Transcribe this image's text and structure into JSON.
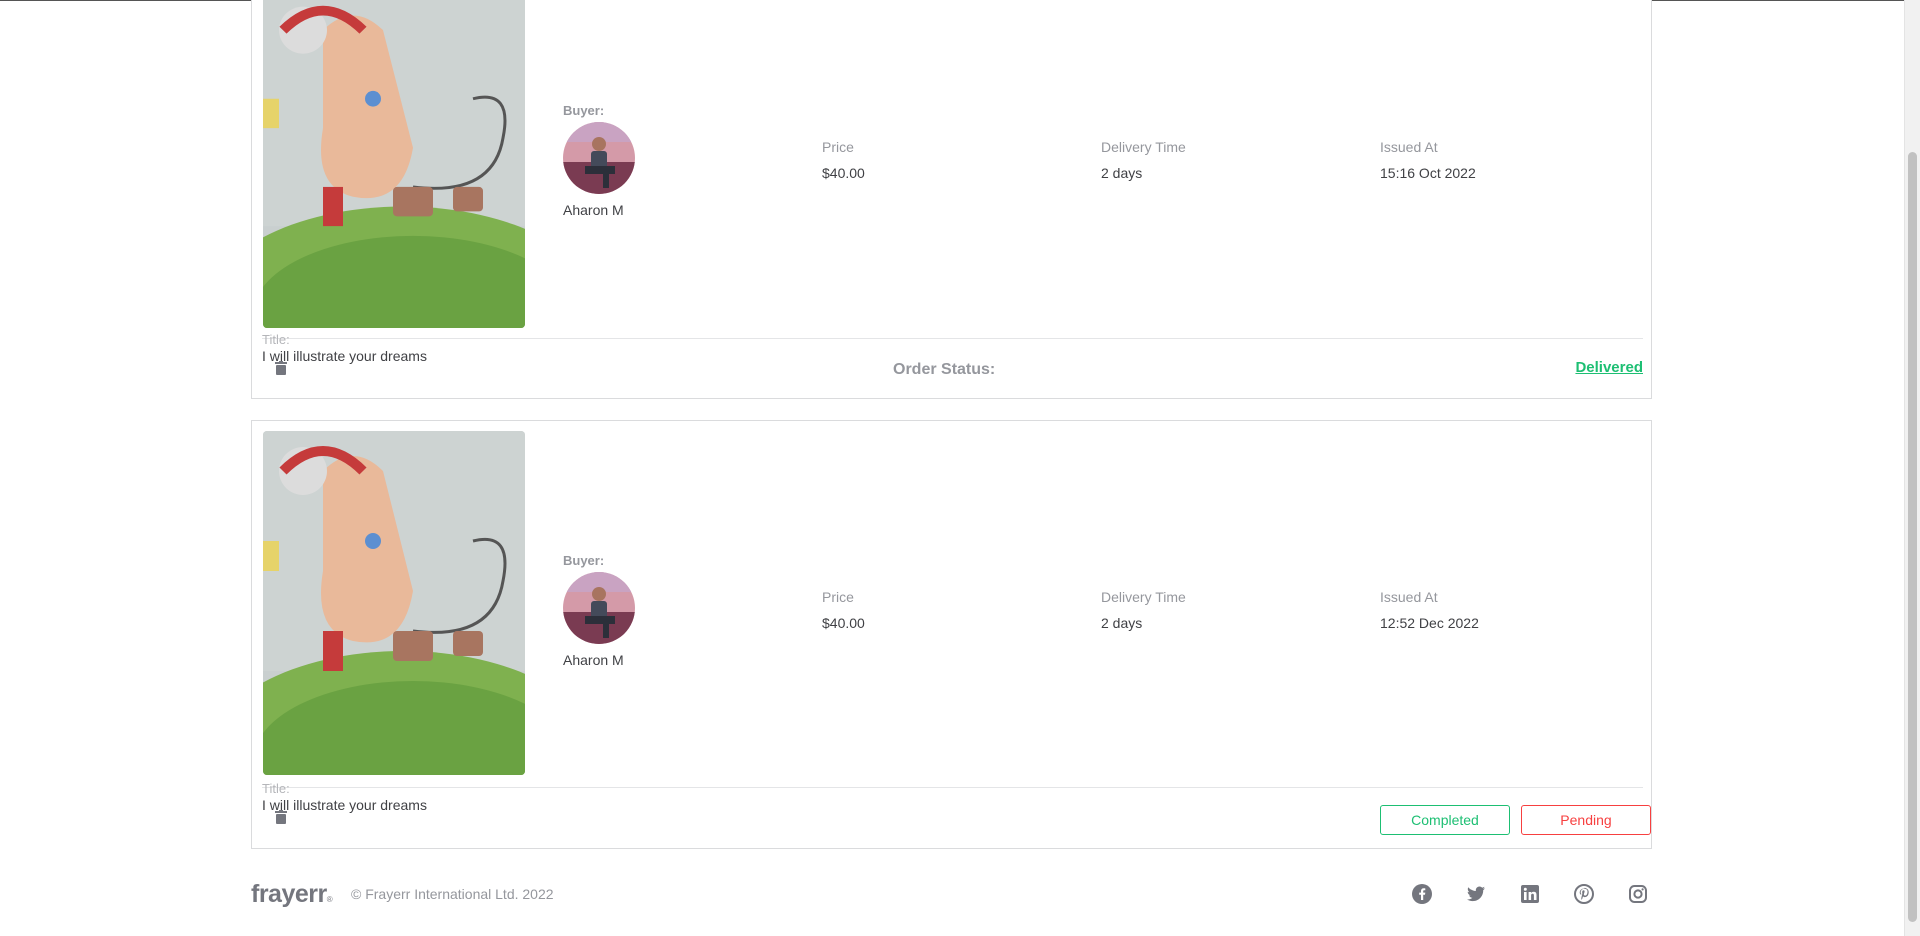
{
  "orders": [
    {
      "buyer_label": "Buyer:",
      "buyer_name": "Aharon M",
      "price_label": "Price",
      "price": "$40.00",
      "delivery_label": "Delivery Time",
      "delivery": "2 days",
      "issued_label": "Issued At",
      "issued": "15:16 Oct 2022",
      "title_label": "Title:",
      "title": "I will illustrate your dreams",
      "order_status_label": "Order Status:",
      "status": "Delivered"
    },
    {
      "buyer_label": "Buyer:",
      "buyer_name": "Aharon M",
      "price_label": "Price",
      "price": "$40.00",
      "delivery_label": "Delivery Time",
      "delivery": "2 days",
      "issued_label": "Issued At",
      "issued": "12:52 Dec 2022",
      "title_label": "Title:",
      "title": "I will illustrate your dreams",
      "completed_label": "Completed",
      "pending_label": "Pending"
    }
  ],
  "footer": {
    "logo": "frayerr",
    "logo_mark": "®",
    "copyright": "© Frayerr International Ltd. 2022",
    "social_icons": [
      "facebook-icon",
      "twitter-icon",
      "linkedin-icon",
      "pinterest-icon",
      "instagram-icon"
    ]
  },
  "colors": {
    "accent_green": "#1dbf73",
    "pending_red": "#f74040",
    "muted_text": "#95979d",
    "body_text": "#404145"
  }
}
